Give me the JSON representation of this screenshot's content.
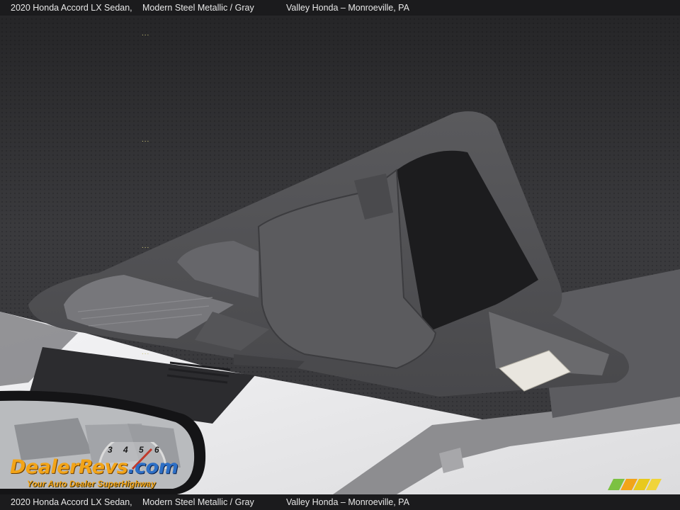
{
  "caption": {
    "title": "2020 Honda Accord LX Sedan,",
    "color": "Modern Steel Metallic / Gray",
    "dealer": "Valley Honda – Monroeville, PA"
  },
  "watermark": {
    "brand_part1": "DealerRevs",
    "brand_part2": ".com",
    "tagline": "Your Auto Dealer SuperHighway",
    "gauge_digits": "3 4 5 6"
  },
  "decor": {
    "dots": "...",
    "accent_orange": "#f2a418",
    "accent_blue": "#2d6fc6"
  }
}
